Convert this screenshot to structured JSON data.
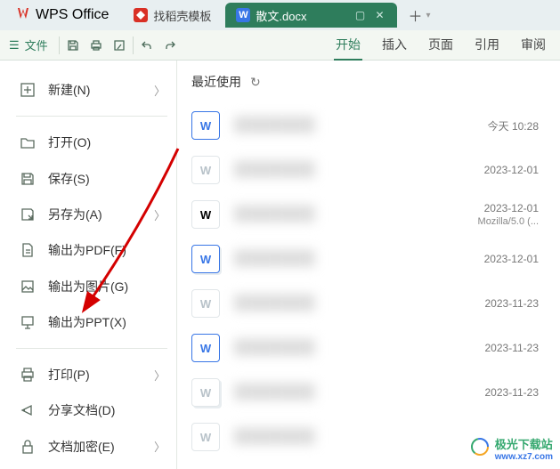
{
  "app_name": "WPS Office",
  "tabs": [
    {
      "label": "找稻壳模板",
      "glyph_class": "g-red"
    },
    {
      "label": "散文.docx",
      "glyph_class": "g-blue",
      "active": true
    }
  ],
  "toolbar": {
    "menu_label": "文件"
  },
  "ribbon": {
    "items": [
      "开始",
      "插入",
      "页面",
      "引用",
      "审阅"
    ],
    "active": 0
  },
  "sidebar": [
    {
      "icon": "new",
      "label": "新建(N)",
      "chev": true,
      "group": 0
    },
    {
      "icon": "open",
      "label": "打开(O)",
      "chev": false,
      "group": 1
    },
    {
      "icon": "save",
      "label": "保存(S)",
      "chev": false,
      "group": 1
    },
    {
      "icon": "saveas",
      "label": "另存为(A)",
      "chev": true,
      "group": 1
    },
    {
      "icon": "pdf",
      "label": "输出为PDF(F)",
      "chev": false,
      "group": 1
    },
    {
      "icon": "image",
      "label": "输出为图片(G)",
      "chev": false,
      "group": 1
    },
    {
      "icon": "ppt",
      "label": "输出为PPT(X)",
      "chev": false,
      "group": 1
    },
    {
      "icon": "print",
      "label": "打印(P)",
      "chev": true,
      "group": 2
    },
    {
      "icon": "share",
      "label": "分享文档(D)",
      "chev": false,
      "group": 2
    },
    {
      "icon": "lock",
      "label": "文档加密(E)",
      "chev": true,
      "group": 2
    }
  ],
  "recent_header": "最近使用",
  "files": [
    {
      "style": "docx",
      "date": "今天  10:28",
      "sub": ""
    },
    {
      "style": "dim",
      "date": "2023-12-01",
      "sub": ""
    },
    {
      "style": "plain",
      "date": "2023-12-01",
      "sub": "Mozilla/5.0 (..."
    },
    {
      "style": "docx shadow",
      "date": "2023-12-01",
      "sub": ""
    },
    {
      "style": "dim",
      "date": "2023-11-23",
      "sub": ""
    },
    {
      "style": "docx",
      "date": "2023-11-23",
      "sub": ""
    },
    {
      "style": "dim shadow",
      "date": "2023-11-23",
      "sub": ""
    },
    {
      "style": "dim",
      "date": "",
      "sub": ""
    }
  ],
  "watermark": {
    "t1": "极光下载站",
    "t2": "www.xz7.com"
  }
}
